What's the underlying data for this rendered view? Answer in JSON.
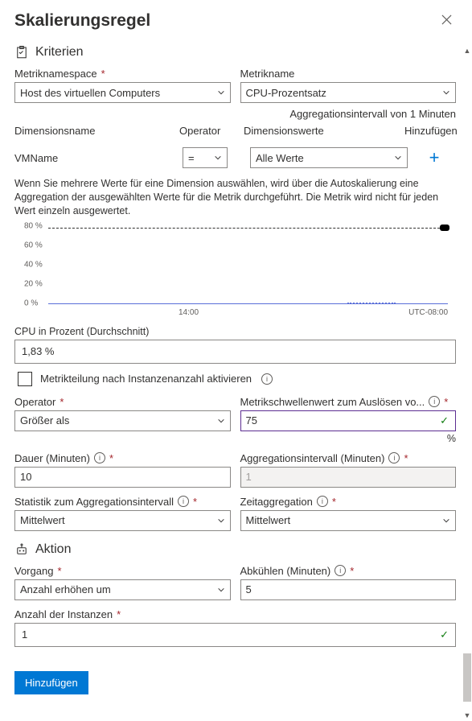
{
  "title": "Skalierungsregel",
  "sections": {
    "criteria": "Kriterien",
    "action": "Aktion"
  },
  "labels": {
    "metric_namespace": "Metriknamespace",
    "metric_name": "Metrikname",
    "agg_interval_info": "Aggregationsintervall von 1 Minuten",
    "dim_name": "Dimensionsname",
    "operator_col": "Operator",
    "dim_values": "Dimensionswerte",
    "add_col": "Hinzufügen",
    "cpu_avg": "CPU in Prozent (Durchschnitt)",
    "divide_metric": "Metrikteilung nach Instanzenanzahl aktivieren",
    "operator": "Operator",
    "threshold": "Metrikschwellenwert zum Auslösen vo...",
    "duration": "Dauer (Minuten)",
    "agg_interval_min": "Aggregationsintervall (Minuten)",
    "agg_stat": "Statistik zum Aggregationsintervall",
    "time_agg": "Zeitaggregation",
    "operation": "Vorgang",
    "cooldown": "Abkühlen (Minuten)",
    "instance_count": "Anzahl der Instanzen"
  },
  "values": {
    "metric_namespace": "Host des virtuellen Computers",
    "metric_name": "CPU-Prozentsatz",
    "dim_name": "VMName",
    "dim_operator": "=",
    "dim_values": "Alle Werte",
    "cpu_avg_value": "1,83 %",
    "operator": "Größer als",
    "threshold": "75",
    "threshold_unit": "%",
    "duration": "10",
    "agg_interval_min": "1",
    "agg_stat": "Mittelwert",
    "time_agg": "Mittelwert",
    "operation": "Anzahl erhöhen um",
    "cooldown": "5",
    "instance_count": "1"
  },
  "help_text": "Wenn Sie mehrere Werte für eine Dimension auswählen, wird über die Autoskalierung eine Aggregation der ausgewählten Werte für die Metrik durchgeführt. Die Metrik wird nicht für jeden Wert einzeln ausgewertet.",
  "chart_data": {
    "type": "line",
    "ylabel": "%",
    "ylim": [
      0,
      80
    ],
    "ticks": [
      "0 %",
      "20 %",
      "40 %",
      "60 %",
      "80 %"
    ],
    "xticks": [
      "14:00",
      "UTC-08:00"
    ],
    "series": [
      {
        "name": "CPU %",
        "approx_value": 1.83
      }
    ],
    "threshold_line": 80
  },
  "button": {
    "submit": "Hinzufügen"
  }
}
